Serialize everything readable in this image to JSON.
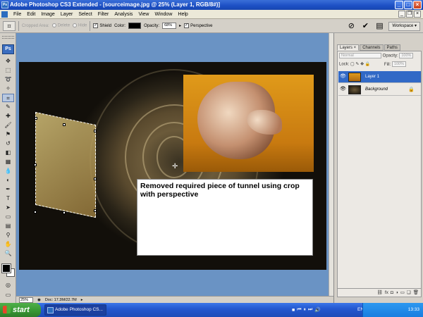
{
  "window": {
    "title": "Adobe Photoshop CS3 Extended - [sourceimage.jpg @ 25% (Layer 1, RGB/8#)]"
  },
  "menu": [
    "File",
    "Edit",
    "Image",
    "Layer",
    "Select",
    "Filter",
    "Analysis",
    "View",
    "Window",
    "Help"
  ],
  "options_bar": {
    "cropped_area_label": "Cropped Area:",
    "delete_label": "Delete",
    "hide_label": "Hide",
    "shield_label": "Shield",
    "color_label": "Color:",
    "opacity_label": "Opacity:",
    "opacity_value": "68%",
    "perspective_label": "Perspective",
    "workspace_label": "Workspace ▾"
  },
  "canvas": {
    "note_text": "Removed required piece of tunnel using crop with perspective"
  },
  "status": {
    "zoom": "25%",
    "doc": "Doc: 17.3M/22.7M"
  },
  "layers_panel": {
    "tabs": [
      "Layers ×",
      "Channels",
      "Paths"
    ],
    "blend_mode": "Normal",
    "opacity_label": "Opacity:",
    "opacity_value": "100%",
    "lock_label": "Lock:",
    "fill_label": "Fill:",
    "fill_value": "100%",
    "layers": [
      {
        "name": "Layer 1",
        "selected": true
      },
      {
        "name": "Background",
        "selected": false
      }
    ]
  },
  "taskbar": {
    "start_label": "start",
    "task_label": "Adobe Photoshop CS...",
    "lang": "EN",
    "clock": "13:33"
  }
}
